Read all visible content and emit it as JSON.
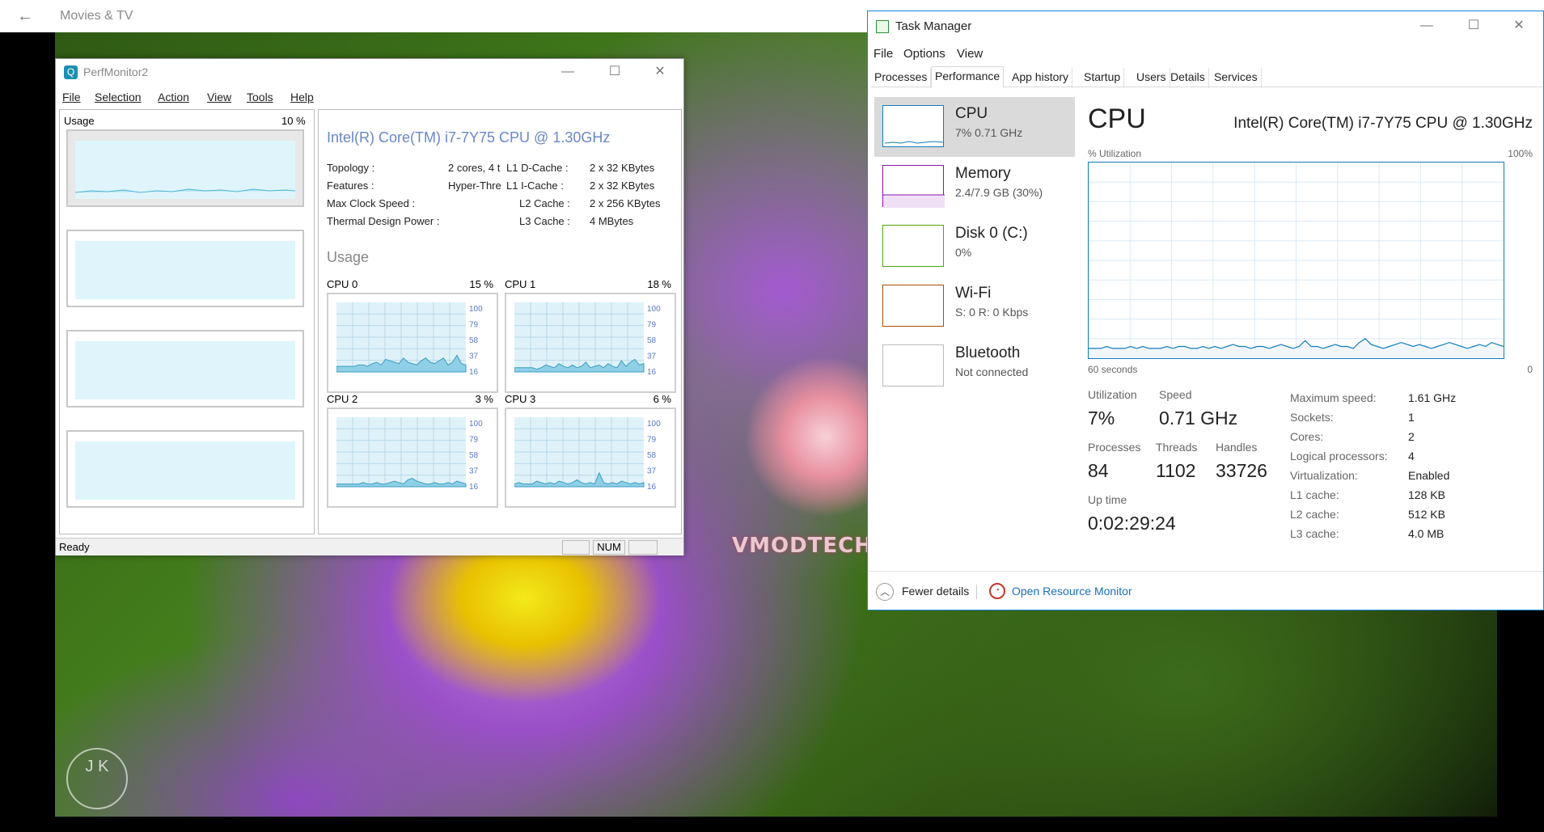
{
  "movies_tv": {
    "title": "Movies & TV",
    "back_icon": "←"
  },
  "watermark": "VMODTECH.COM",
  "jk_logo": "J K",
  "perfmon": {
    "title": "PerfMonitor2",
    "menu": [
      "File",
      "Selection",
      "Action",
      "View",
      "Tools",
      "Help"
    ],
    "left_panel": {
      "usage_label": "Usage",
      "usage_pct": "10 %"
    },
    "cpu_name": "Intel(R) Core(TM) i7-7Y75 CPU @ 1.30GHz",
    "info": [
      {
        "label": "Topology :",
        "value": "2 cores, 4 t"
      },
      {
        "label": "Features :",
        "value": "Hyper-Thre"
      },
      {
        "label": "Max Clock Speed :",
        "value": ""
      },
      {
        "label": "Thermal Design Power :",
        "value": ""
      }
    ],
    "cache": [
      {
        "label": "L1 D-Cache :",
        "value": "2 x 32 KBytes"
      },
      {
        "label": "L1 I-Cache :",
        "value": "2 x 32 KBytes"
      },
      {
        "label": "L2 Cache :",
        "value": "2 x 256 KBytes"
      },
      {
        "label": "L3 Cache :",
        "value": "4 MBytes"
      }
    ],
    "usage_title": "Usage",
    "axis_ticks": [
      "100",
      "79",
      "58",
      "37",
      "16"
    ],
    "cpus": [
      {
        "name": "CPU 0",
        "pct": "15 %",
        "values": [
          8,
          8,
          8,
          8,
          8,
          10,
          10,
          8,
          12,
          14,
          10,
          18,
          16,
          14,
          12,
          20,
          14,
          12,
          10,
          16,
          20,
          14,
          12,
          16,
          20,
          10,
          14,
          24,
          12,
          10
        ]
      },
      {
        "name": "CPU 1",
        "pct": "18 %",
        "values": [
          6,
          6,
          6,
          6,
          6,
          4,
          6,
          10,
          8,
          6,
          12,
          8,
          6,
          10,
          6,
          8,
          14,
          6,
          8,
          10,
          6,
          12,
          8,
          6,
          16,
          8,
          14,
          18,
          10,
          12
        ]
      },
      {
        "name": "CPU 2",
        "pct": "3 %",
        "values": [
          4,
          4,
          4,
          4,
          4,
          4,
          6,
          4,
          4,
          6,
          4,
          4,
          6,
          8,
          6,
          4,
          10,
          12,
          8,
          6,
          4,
          4,
          6,
          4,
          4,
          6,
          4,
          8,
          6,
          4
        ]
      },
      {
        "name": "CPU 3",
        "pct": "6 %",
        "values": [
          4,
          6,
          4,
          4,
          4,
          8,
          6,
          4,
          6,
          4,
          8,
          6,
          4,
          6,
          10,
          6,
          4,
          6,
          4,
          20,
          6,
          4,
          6,
          4,
          8,
          6,
          4,
          6,
          4,
          6
        ]
      }
    ],
    "status": {
      "ready": "Ready",
      "num": "NUM"
    }
  },
  "taskmgr": {
    "title": "Task Manager",
    "menu": [
      "File",
      "Options",
      "View"
    ],
    "tabs": [
      "Processes",
      "Performance",
      "App history",
      "Startup",
      "Users",
      "Details",
      "Services"
    ],
    "side": [
      {
        "name": "CPU",
        "sub": "7%  0.71 GHz",
        "color": "#117dbb"
      },
      {
        "name": "Memory",
        "sub": "2.4/7.9 GB (30%)",
        "color": "#8b12ae"
      },
      {
        "name": "Disk 0 (C:)",
        "sub": "0%",
        "color": "#4da60c"
      },
      {
        "name": "Wi-Fi",
        "sub": "S: 0 R: 0 Kbps",
        "color": "#a74f01"
      },
      {
        "name": "Bluetooth",
        "sub": "Not connected",
        "color": "#bbbbbb"
      }
    ],
    "cpu_heading": "CPU",
    "cpu_model": "Intel(R) Core(TM) i7-7Y75 CPU @ 1.30GHz",
    "util_label": "% Utilization",
    "util_max": "100%",
    "time_label": "60 seconds",
    "time_end": "0",
    "util_history": [
      5,
      5,
      5,
      6,
      5,
      5,
      5,
      6,
      5,
      6,
      5,
      5,
      5,
      6,
      5,
      6,
      6,
      5,
      5,
      6,
      5,
      6,
      5,
      6,
      7,
      6,
      6,
      5,
      6,
      6,
      5,
      6,
      7,
      6,
      5,
      6,
      9,
      6,
      6,
      5,
      6,
      7,
      6,
      6,
      5,
      8,
      10,
      7,
      6,
      5,
      6,
      7,
      8,
      7,
      6,
      7,
      6,
      5,
      6,
      7,
      8,
      7,
      6,
      5,
      6,
      7,
      6,
      8,
      7,
      6
    ],
    "stats": {
      "utilization_label": "Utilization",
      "utilization": "7%",
      "speed_label": "Speed",
      "speed": "0.71 GHz",
      "processes_label": "Processes",
      "processes": "84",
      "threads_label": "Threads",
      "threads": "1102",
      "handles_label": "Handles",
      "handles": "33726",
      "uptime_label": "Up time",
      "uptime": "0:02:29:24"
    },
    "details": [
      {
        "label": "Maximum speed:",
        "value": "1.61 GHz"
      },
      {
        "label": "Sockets:",
        "value": "1"
      },
      {
        "label": "Cores:",
        "value": "2"
      },
      {
        "label": "Logical processors:",
        "value": "4"
      },
      {
        "label": "Virtualization:",
        "value": "Enabled"
      },
      {
        "label": "L1 cache:",
        "value": "128 KB"
      },
      {
        "label": "L2 cache:",
        "value": "512 KB"
      },
      {
        "label": "L3 cache:",
        "value": "4.0 MB"
      }
    ],
    "fewer_details": "Fewer details",
    "open_resource_monitor": "Open Resource Monitor"
  }
}
